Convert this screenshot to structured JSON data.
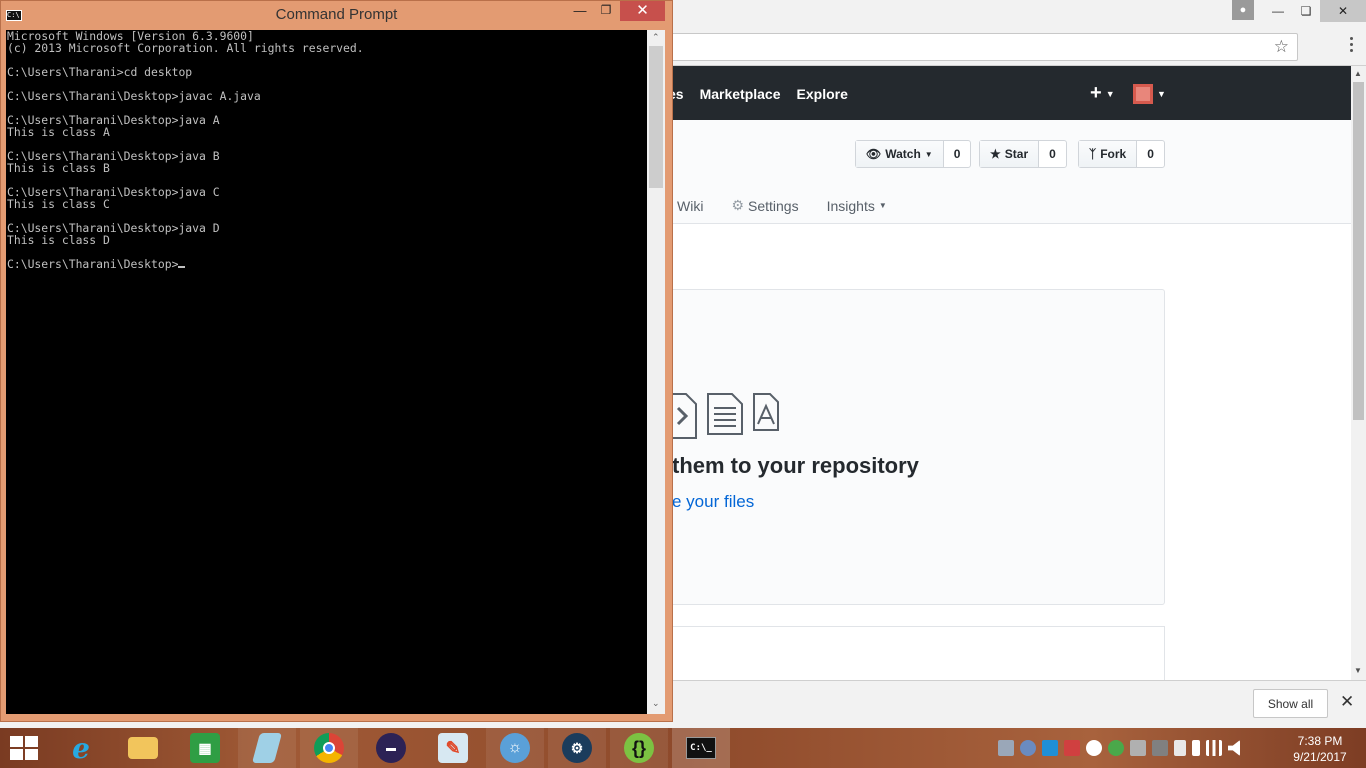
{
  "cmd": {
    "title": "Command Prompt",
    "lines": [
      "Microsoft Windows [Version 6.3.9600]",
      "(c) 2013 Microsoft Corporation. All rights reserved.",
      "",
      "C:\\Users\\Tharani>cd desktop",
      "",
      "C:\\Users\\Tharani\\Desktop>javac A.java",
      "",
      "C:\\Users\\Tharani\\Desktop>java A",
      "This is class A",
      "",
      "C:\\Users\\Tharani\\Desktop>java B",
      "This is class B",
      "",
      "C:\\Users\\Tharani\\Desktop>java C",
      "This is class C",
      "",
      "C:\\Users\\Tharani\\Desktop>java D",
      "This is class D",
      ""
    ],
    "prompt": "C:\\Users\\Tharani\\Desktop>"
  },
  "github": {
    "nav": [
      "es",
      "Marketplace",
      "Explore"
    ],
    "watch_label": "Watch",
    "watch_count": "0",
    "star_label": "Star",
    "star_count": "0",
    "fork_label": "Fork",
    "fork_count": "0",
    "tabs": {
      "wiki": "Wiki",
      "settings": "Settings",
      "insights": "Insights"
    },
    "blank_title": "them to your repository",
    "blank_link": "e your files"
  },
  "downloads": {
    "show_all": "Show all"
  },
  "clock": {
    "time": "7:38 PM",
    "date": "9/21/2017"
  },
  "colors": {
    "cmd_border": "#e39b72",
    "gh_header": "#24292e",
    "link": "#0366d6"
  }
}
